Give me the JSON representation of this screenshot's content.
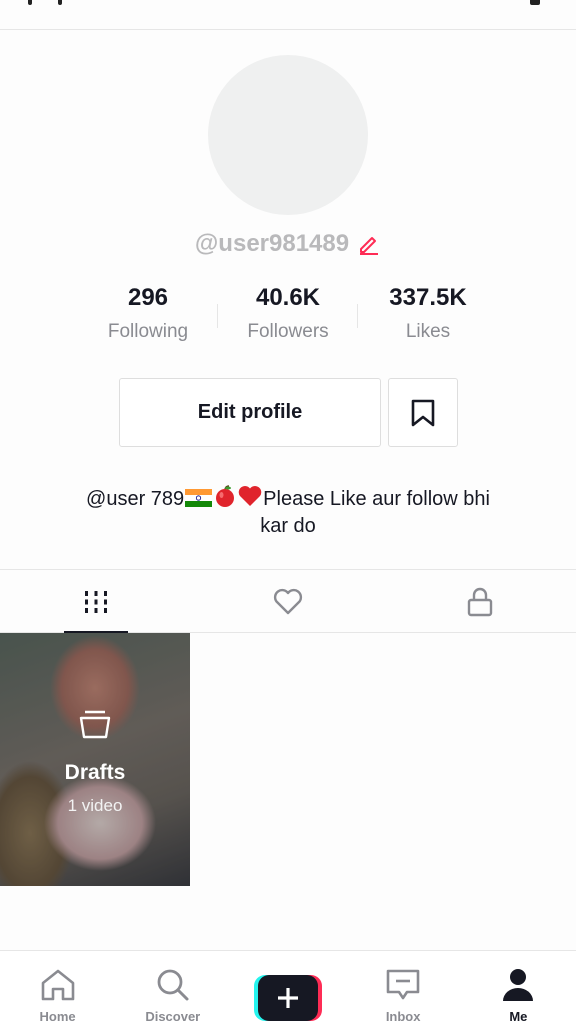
{
  "profile": {
    "username": "@user981489",
    "bio_line1_prefix": "@user 789",
    "bio_line1_suffix": "Please Like aur follow bhi",
    "bio_line2": "kar do"
  },
  "stats": [
    {
      "value": "296",
      "label": "Following"
    },
    {
      "value": "40.6K",
      "label": "Followers"
    },
    {
      "value": "337.5K",
      "label": "Likes"
    }
  ],
  "actions": {
    "edit_profile_label": "Edit profile"
  },
  "tabs": [
    {
      "icon": "grid-icon",
      "active": true
    },
    {
      "icon": "heart-outline-icon",
      "active": false
    },
    {
      "icon": "lock-icon",
      "active": false
    }
  ],
  "drafts": {
    "title": "Drafts",
    "count": "1 video"
  },
  "nav": {
    "home": "Home",
    "discover": "Discover",
    "inbox": "Inbox",
    "me": "Me"
  },
  "colors": {
    "accent_pink": "#fe2c55",
    "accent_cyan": "#25f4ee",
    "text_primary": "#161823",
    "text_secondary": "#8a8b91"
  }
}
